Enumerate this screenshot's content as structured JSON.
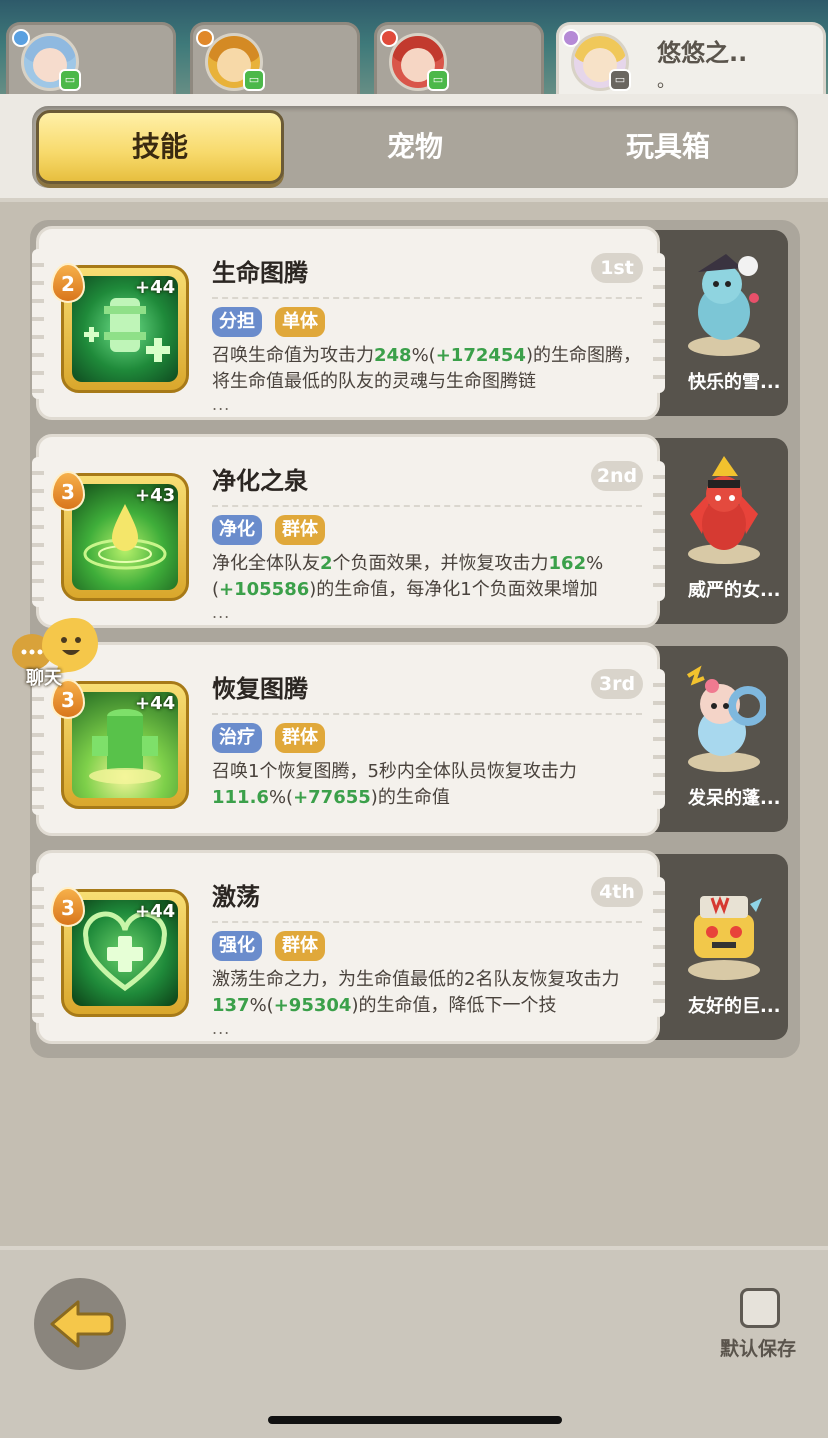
{
  "heroes": {
    "active_name": "悠悠之..",
    "active_sub": "。"
  },
  "tabs": [
    "技能",
    "宠物",
    "玩具箱"
  ],
  "skills": [
    {
      "name": "生命图腾",
      "rank": "1st",
      "level": "2",
      "bonus": "+44",
      "tags": [
        "分担",
        "单体"
      ],
      "desc_parts": [
        "召唤生命值为攻击力",
        "248",
        "%(",
        "+172454",
        ")的生命图腾，将生命值最低的队友的灵魂与生命图腾链"
      ],
      "more": "...",
      "pet_name": "快乐的雪..."
    },
    {
      "name": "净化之泉",
      "rank": "2nd",
      "level": "3",
      "bonus": "+43",
      "tags": [
        "净化",
        "群体"
      ],
      "desc_parts": [
        "净化全体队友",
        "2",
        "个负面效果，并恢复攻击力",
        "162",
        "%(",
        "+105586",
        ")的生命值，每净化1个负面效果增加"
      ],
      "more": "...",
      "pet_name": "威严的女..."
    },
    {
      "name": "恢复图腾",
      "rank": "3rd",
      "level": "3",
      "bonus": "+44",
      "tags": [
        "治疗",
        "群体"
      ],
      "desc_parts": [
        "召唤1个恢复图腾，5秒内全体队员恢复攻击力",
        "111.6",
        "%(",
        "+77655",
        ")的生命值"
      ],
      "more": "",
      "pet_name": "发呆的蓬..."
    },
    {
      "name": "激荡",
      "rank": "4th",
      "level": "3",
      "bonus": "+44",
      "tags": [
        "强化",
        "群体"
      ],
      "desc_parts": [
        "激荡生命之力，为生命值最低的2名队友恢复攻击力",
        "137",
        "%(",
        "+95304",
        ")的生命值，降低下一个技"
      ],
      "more": "...",
      "pet_name": "友好的巨..."
    }
  ],
  "chat_label": "聊天",
  "save_label": "默认保存",
  "colors": {
    "accent_gold": "#f7d96a",
    "highlight_green": "#3ba04a",
    "tag_blue": "#6a8ccc",
    "tag_gold": "#e0a83a"
  }
}
